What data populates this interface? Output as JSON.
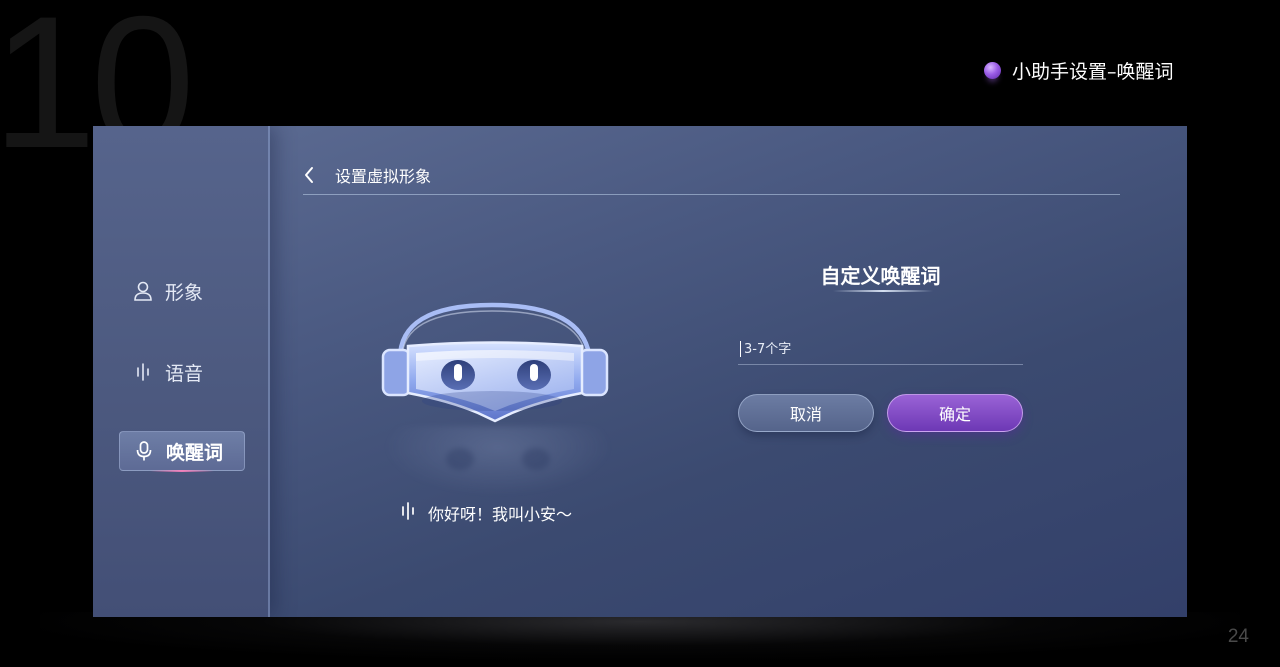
{
  "slide": {
    "number": "10",
    "section_title": "小助手设置–唤醒词",
    "page_number": "24"
  },
  "sidebar": {
    "items": [
      {
        "label": "形象",
        "icon": "person-icon",
        "active": false
      },
      {
        "label": "语音",
        "icon": "voice-wave-icon",
        "active": false
      },
      {
        "label": "唤醒词",
        "icon": "microphone-icon",
        "active": true
      }
    ]
  },
  "header": {
    "back_icon": "chevron-left-icon",
    "title": "设置虚拟形象"
  },
  "assistant": {
    "greeting": "你好呀！我叫小安～",
    "greeting_icon": "voice-wave-icon"
  },
  "form": {
    "title": "自定义唤醒词",
    "input_value": "",
    "input_placeholder": "3-7个字",
    "cancel_label": "取消",
    "confirm_label": "确定"
  },
  "colors": {
    "accent_purple": "#8a4fd0",
    "screen_bg": "#4a5981",
    "sidebar_bg": "#4d5a80"
  }
}
